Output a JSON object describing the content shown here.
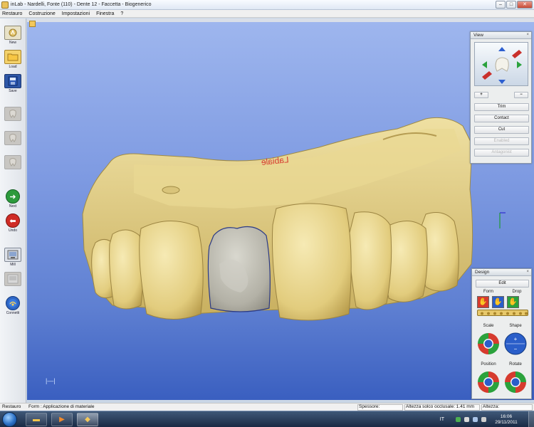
{
  "window": {
    "title": "inLab - Nardelli, Fonte (110) - Dente  12 - Faccetta - Biogenerico",
    "min_label": "–",
    "max_label": "□",
    "close_label": "✕"
  },
  "menu": [
    "Restauro",
    "Costruzione",
    "Impostazioni",
    "Finestra",
    "?"
  ],
  "toolbar": [
    {
      "label": "New",
      "icon": "new-icon",
      "enabled": true
    },
    {
      "label": "Load",
      "icon": "folder-icon",
      "enabled": true
    },
    {
      "label": "Save",
      "icon": "save-icon",
      "enabled": true
    },
    {
      "label": "",
      "icon": "tooth-icon",
      "enabled": false
    },
    {
      "label": "",
      "icon": "tooth-icon",
      "enabled": false
    },
    {
      "label": "",
      "icon": "tooth-icon",
      "enabled": false
    },
    {
      "label": "Next",
      "icon": "next-arrow-icon",
      "enabled": true
    },
    {
      "label": "Undo",
      "icon": "undo-arrow-icon",
      "enabled": true
    },
    {
      "label": "Mill",
      "icon": "mill-icon",
      "enabled": true
    },
    {
      "label": "",
      "icon": "disabled-icon",
      "enabled": false
    },
    {
      "label": "Connetti",
      "icon": "connect-icon",
      "enabled": true
    }
  ],
  "viewport": {
    "annotation": "Labiale",
    "scale_marker": "|—|"
  },
  "view_panel": {
    "title": "View",
    "close": "×",
    "zoom_in": "+",
    "zoom_out": "−",
    "buttons": [
      {
        "label": "Trim",
        "enabled": true
      },
      {
        "label": "Contact",
        "enabled": true
      },
      {
        "label": "Cut",
        "enabled": true
      },
      {
        "label": "Enabled",
        "enabled": false
      },
      {
        "label": "Antagonist",
        "enabled": false
      }
    ]
  },
  "design_panel": {
    "title": "Design",
    "close": "×",
    "edit": "Edit",
    "form": "Form",
    "drop": "Drop",
    "scale": "Scale",
    "shape": "Shape",
    "position": "Position",
    "rotate": "Rotate"
  },
  "status": {
    "left": "Restauro",
    "form": "Form : Applicazione di materiale",
    "thickness_label": "Spessore:",
    "groove_height": "Altezza solco occlusale: 1.41 mm",
    "height_label": "Altezza:"
  },
  "taskbar": {
    "language": "IT",
    "time": "16:06",
    "date": "29/11/2011"
  },
  "colors": {
    "model": "#e6d48c",
    "veneer": "#b8b6ab",
    "annotation": "#d63a2e"
  }
}
